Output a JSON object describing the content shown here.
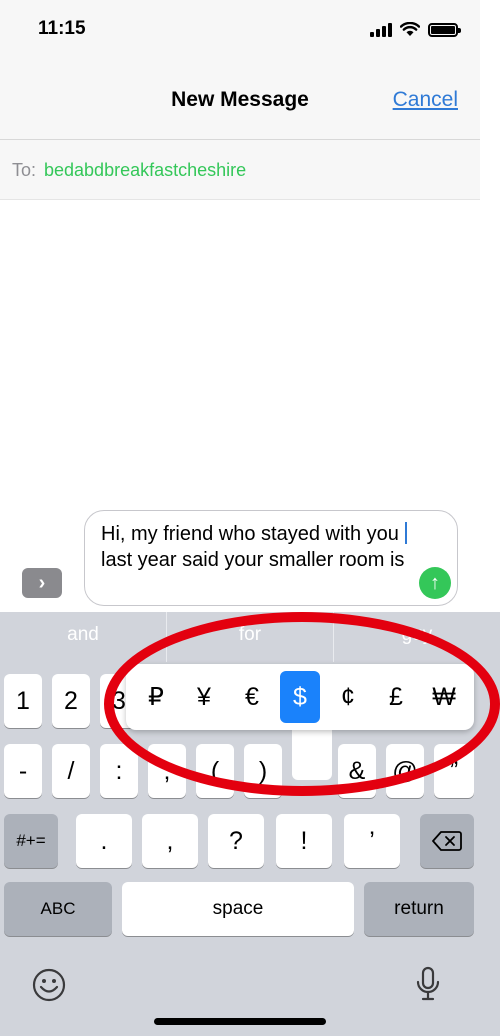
{
  "status_bar": {
    "time": "11:15"
  },
  "nav": {
    "title": "New Message",
    "cancel_label": "Cancel"
  },
  "to": {
    "label": "To:",
    "value": "bedabdbreakfastcheshire"
  },
  "compose": {
    "text_before_caret": "Hi, my friend who stayed with you ",
    "text_after_caret": "last year said your smaller room is"
  },
  "suggestions": [
    "and",
    "for",
    "guy"
  ],
  "keys": {
    "row1": [
      "1",
      "2",
      "3"
    ],
    "row2": [
      "-",
      "/",
      ":",
      ";",
      "(",
      ")",
      "&",
      "@",
      "”"
    ],
    "row3": [
      ".",
      ",",
      "?",
      "!",
      "’"
    ],
    "symbols_toggle": "#+=",
    "abc_label": "ABC",
    "space_label": "space",
    "return_label": "return"
  },
  "currency_popover": {
    "options": [
      "₽",
      "¥",
      "€",
      "$",
      "¢",
      "£",
      "₩"
    ],
    "selected": "$"
  },
  "icons": {
    "expand": "chevron-right-icon",
    "send": "send-arrow-icon",
    "delete": "backspace-icon",
    "emoji": "emoji-icon",
    "mic": "microphone-icon"
  },
  "colors": {
    "accent": "#2f7ad6",
    "green": "#34c759",
    "selected": "#1a82fb",
    "highlight_ring": "#e3000f"
  }
}
